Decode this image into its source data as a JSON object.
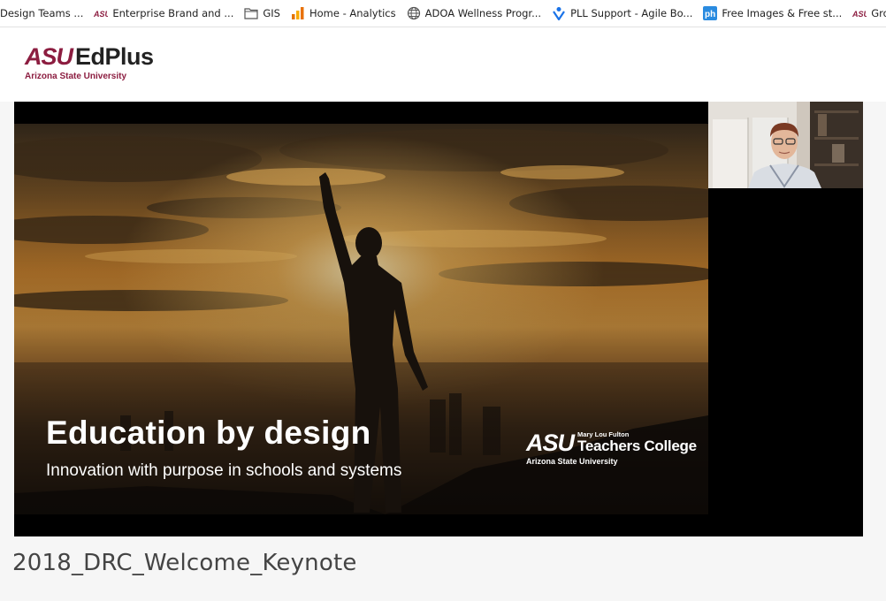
{
  "bookmarks": [
    {
      "label": "Design Teams ...",
      "icon": "none"
    },
    {
      "label": "Enterprise Brand and ...",
      "icon": "asu-icon"
    },
    {
      "label": "GIS",
      "icon": "folder-icon"
    },
    {
      "label": "Home - Analytics",
      "icon": "analytics-icon"
    },
    {
      "label": "ADOA Wellness Progr...",
      "icon": "globe-icon"
    },
    {
      "label": "PLL Support - Agile Bo...",
      "icon": "agile-icon"
    },
    {
      "label": "Free Images & Free st...",
      "icon": "ph-icon"
    },
    {
      "label": "Group Fitness",
      "icon": "asu-icon"
    }
  ],
  "header": {
    "logo_mark": "ASU",
    "logo_name": "EdPlus",
    "logo_sub": "Arizona State University"
  },
  "slide": {
    "title": "Education by design",
    "subtitle": "Innovation with purpose in schools and systems",
    "college_mark": "ASU",
    "college_small": "Mary Lou Fulton",
    "college_name": "Teachers College",
    "college_university": "Arizona State University"
  },
  "video": {
    "title": "2018_DRC_Welcome_Keynote"
  },
  "colors": {
    "asu_maroon": "#8c1d40",
    "asu_gold": "#ffc627",
    "background": "#f6f6f6"
  }
}
